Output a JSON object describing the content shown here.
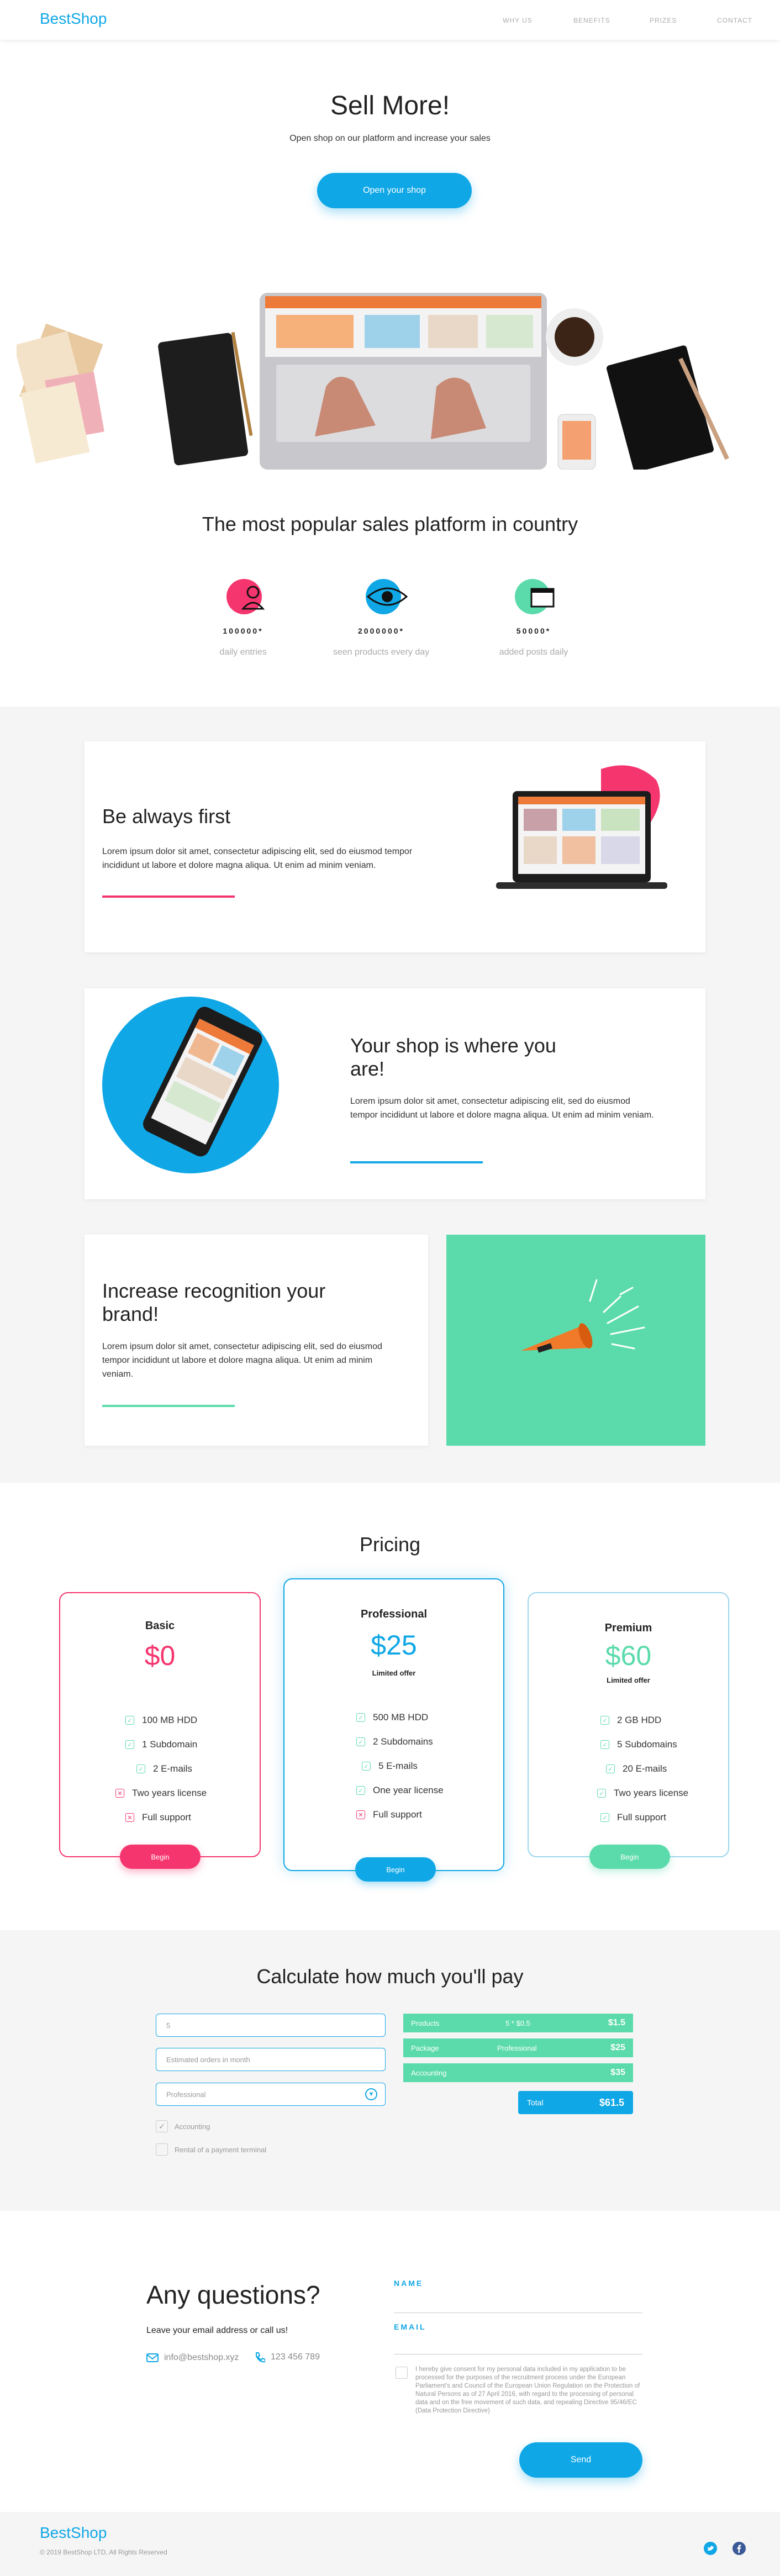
{
  "header": {
    "logo": "BestShop",
    "nav": [
      "WHY US",
      "BENEFITS",
      "PRIZES",
      "CONTACT"
    ]
  },
  "hero": {
    "title": "Sell More!",
    "subtitle": "Open shop on our platform and increase your sales",
    "cta": "Open your shop"
  },
  "stats": {
    "title": "The most popular sales platform in country",
    "items": [
      {
        "value": "100000*",
        "label": "daily entries",
        "icon": "person-icon",
        "color": "#f5356e"
      },
      {
        "value": "2000000*",
        "label": "seen products every day",
        "icon": "eye-icon",
        "color": "#10a7e6"
      },
      {
        "value": "50000*",
        "label": "added posts daily",
        "icon": "window-icon",
        "color": "#5bdbab"
      }
    ]
  },
  "features": [
    {
      "title": "Be always first",
      "text": "Lorem ipsum dolor sit amet, consectetur adipiscing elit, sed do eiusmod tempor incididunt ut labore et dolore magna aliqua. Ut enim ad minim veniam.",
      "color": "#f5356e"
    },
    {
      "title": "Your shop is where you are!",
      "text": "Lorem ipsum dolor sit amet, consectetur adipiscing elit, sed do eiusmod tempor incididunt ut labore et dolore magna aliqua. Ut enim ad minim veniam.",
      "color": "#10a7e6"
    },
    {
      "title": "Increase recognition your brand!",
      "text": "Lorem ipsum dolor sit amet, consectetur adipiscing elit, sed do eiusmod tempor incididunt ut labore et dolore magna aliqua. Ut enim ad minim veniam.",
      "color": "#5bdbab"
    }
  ],
  "pricing": {
    "title": "Pricing",
    "plans": [
      {
        "name": "Basic",
        "price": "$0",
        "limited": "",
        "color": "#f5356e",
        "button": "Begin",
        "features": [
          {
            "text": "100 MB HDD",
            "ok": true
          },
          {
            "text": "1 Subdomain",
            "ok": true
          },
          {
            "text": "2 E-mails",
            "ok": true
          },
          {
            "text": "Two years license",
            "ok": false
          },
          {
            "text": "Full support",
            "ok": false
          }
        ]
      },
      {
        "name": "Professional",
        "price": "$25",
        "limited": "Limited offer",
        "color": "#10a7e6",
        "button": "Begin",
        "features": [
          {
            "text": "500 MB HDD",
            "ok": true
          },
          {
            "text": "2 Subdomains",
            "ok": true
          },
          {
            "text": "5 E-mails",
            "ok": true
          },
          {
            "text": "One year license",
            "ok": true
          },
          {
            "text": "Full support",
            "ok": false
          }
        ]
      },
      {
        "name": "Premium",
        "price": "$60",
        "limited": "Limited offer",
        "color": "#5bdbab",
        "button": "Begin",
        "features": [
          {
            "text": "2 GB HDD",
            "ok": true
          },
          {
            "text": "5 Subdomains",
            "ok": true
          },
          {
            "text": "20 E-mails",
            "ok": true
          },
          {
            "text": "Two years license",
            "ok": true
          },
          {
            "text": "Full support",
            "ok": true
          }
        ]
      }
    ]
  },
  "calculator": {
    "title": "Calculate how much you'll pay",
    "products_value": "5",
    "orders_placeholder": "Estimated orders in month",
    "package_value": "Professional",
    "checkboxes": [
      {
        "label": "Accounting",
        "checked": true
      },
      {
        "label": "Rental of a payment terminal",
        "checked": false
      }
    ],
    "summary": [
      {
        "name": "Products",
        "calc": "5 * $0.5",
        "price": "$1.5"
      },
      {
        "name": "Package",
        "calc": "Professional",
        "price": "$25"
      },
      {
        "name": "Accounting",
        "calc": "",
        "price": "$35"
      }
    ],
    "total_label": "Total",
    "total_value": "$61.5"
  },
  "contact": {
    "title": "Any questions?",
    "subtitle": "Leave your email address or call us!",
    "email": "info@bestshop.xyz",
    "phone": "123 456 789",
    "name_label": "NAME",
    "email_label": "EMAIL",
    "consent": "I hereby give consent for my personal data included in my application to be processed for the purposes of the recruitment process under the European Parliament's and Council of the European Union Regulation on the Protection of Natural Persons as of 27 April 2016, with regard to the processing of personal data and on the free movement of such data, and repealing Directive 95/46/EC (Data Protection Directive)",
    "send": "Send"
  },
  "footer": {
    "logo": "BestShop",
    "copyright": "© 2019 BestShop LTD, All Rights Reserved"
  }
}
